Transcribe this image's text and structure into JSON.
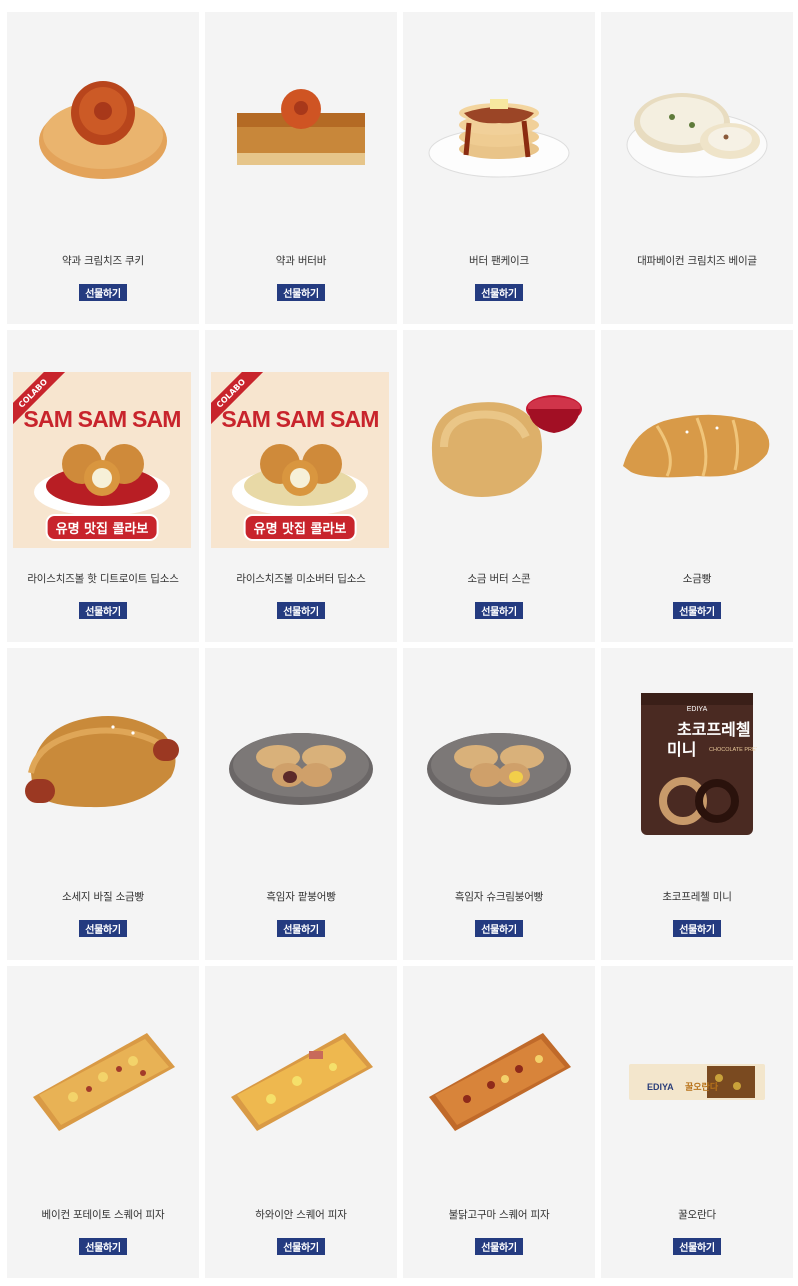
{
  "gift_label": "선물하기",
  "products": [
    {
      "name": "약과 크림치즈 쿠키",
      "image": "yakgwa-cookie",
      "gift": true
    },
    {
      "name": "약과 버터바",
      "image": "yakgwa-butterbar",
      "gift": true
    },
    {
      "name": "버터 팬케이크",
      "image": "pancake",
      "gift": true
    },
    {
      "name": "대파베이컨 크림치즈 베이글",
      "image": "bagel",
      "gift": false
    },
    {
      "name": "라이스치즈볼 핫 디트로이트 딥소스",
      "image": "collab-red",
      "gift": true,
      "collab": {
        "ribbon": "COLABO",
        "title": "SAM SAM SAM",
        "tag": "유명 맛집 콜라보"
      }
    },
    {
      "name": "라이스치즈볼 미소버터 딥소스",
      "image": "collab-cream",
      "gift": true,
      "collab": {
        "ribbon": "COLABO",
        "title": "SAM SAM SAM",
        "tag": "유명 맛집 콜라보"
      }
    },
    {
      "name": "소금 버터 스콘",
      "image": "scone",
      "gift": true
    },
    {
      "name": "소금빵",
      "image": "saltbread",
      "gift": true
    },
    {
      "name": "소세지 바질 소금빵",
      "image": "sausage-bread",
      "gift": true
    },
    {
      "name": "흑임자 팥붕어빵",
      "image": "bungeo-red",
      "gift": true
    },
    {
      "name": "흑임자 슈크림붕어빵",
      "image": "bungeo-cream",
      "gift": true
    },
    {
      "name": "초코프레첼 미니",
      "image": "pretzel-bag",
      "gift": true,
      "package": {
        "brand": "EDIYA",
        "title": "초코프레첼 미니",
        "subtitle": "CHOCOLATE PRETZEL MINI"
      }
    },
    {
      "name": "베이컨 포테이토 스퀘어 피자",
      "image": "pizza-bacon",
      "gift": true
    },
    {
      "name": "하와이안 스퀘어 피자",
      "image": "pizza-hawaiian",
      "gift": true
    },
    {
      "name": "불닭고구마 스퀘어 피자",
      "image": "pizza-buldak",
      "gift": true
    },
    {
      "name": "꿀오란다",
      "image": "oranda-bar",
      "gift": true,
      "package": {
        "brand": "EDIYA",
        "title": "꿀오란다"
      }
    }
  ]
}
